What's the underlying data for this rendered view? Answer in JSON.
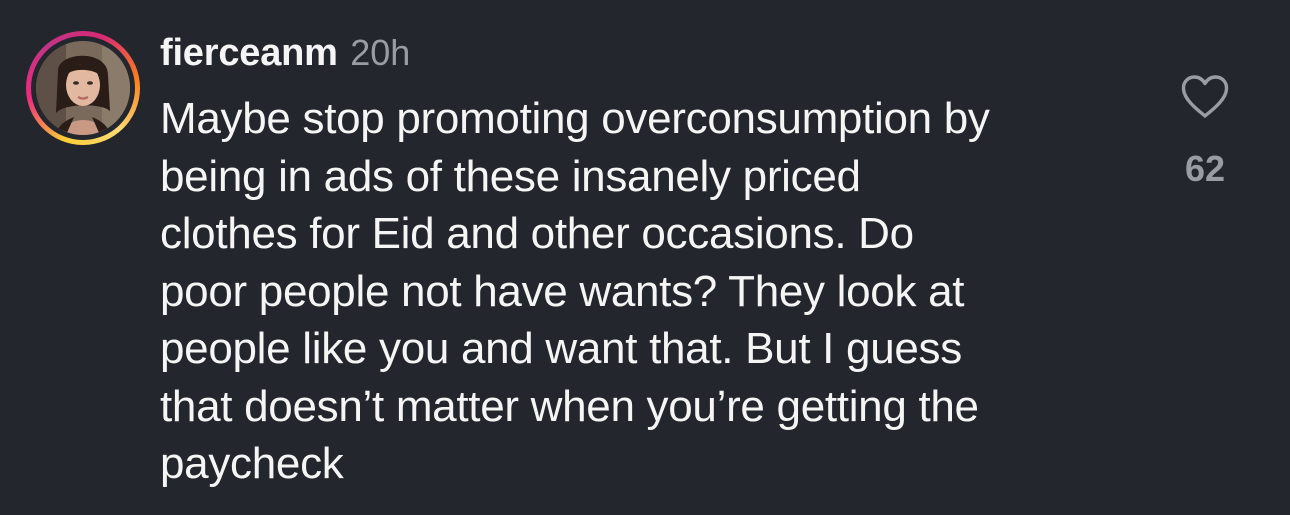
{
  "comment": {
    "username": "fierceanm",
    "timestamp": "20h",
    "text_lines": [
      "Maybe stop promoting overconsumption by",
      "being in ads of these insanely priced",
      "clothes for Eid and other occasions. Do",
      "poor people not have wants? They look at",
      "people like you and want that. But I guess",
      "that doesn’t matter when you’re getting the",
      "paycheck"
    ],
    "like_count": "62",
    "like_icon": "heart-outline-icon"
  },
  "colors": {
    "background": "#24262d",
    "text": "#f5f5f5",
    "muted": "#9a9ca3",
    "story_ring": [
      "#f9ce34",
      "#ee2a7b",
      "#c13584"
    ]
  }
}
